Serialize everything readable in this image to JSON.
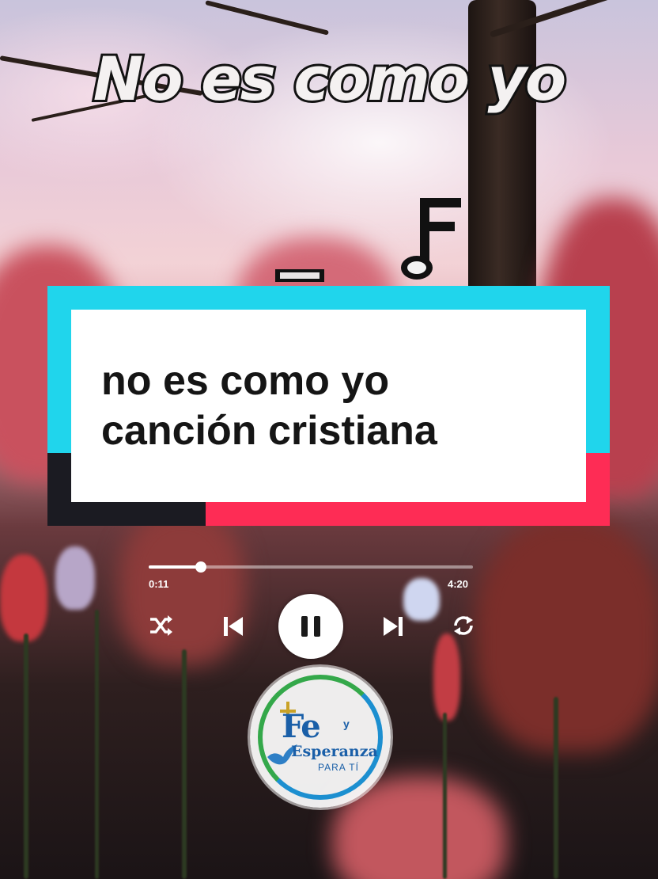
{
  "video": {
    "title": "No es como yo",
    "caption_line1": "no es como yo",
    "caption_line2": "canción cristiana"
  },
  "player": {
    "current_time": "0:11",
    "total_time": "4:20",
    "progress_fraction": 0.16,
    "state": "playing"
  },
  "logo": {
    "name_part1": "Fe",
    "name_connector": "y",
    "name_part2": "Esperanza",
    "tagline": "PARA TÍ"
  },
  "colors": {
    "cyan": "#20d5ec",
    "red": "#fe2c55",
    "dark": "#1b1b22",
    "logo_blue": "#1a5fa8",
    "logo_green": "#34a84a"
  },
  "icons": [
    "music-note-icon",
    "shuffle-icon",
    "previous-icon",
    "pause-icon",
    "next-icon",
    "repeat-icon",
    "dove-icon",
    "cross-icon"
  ]
}
